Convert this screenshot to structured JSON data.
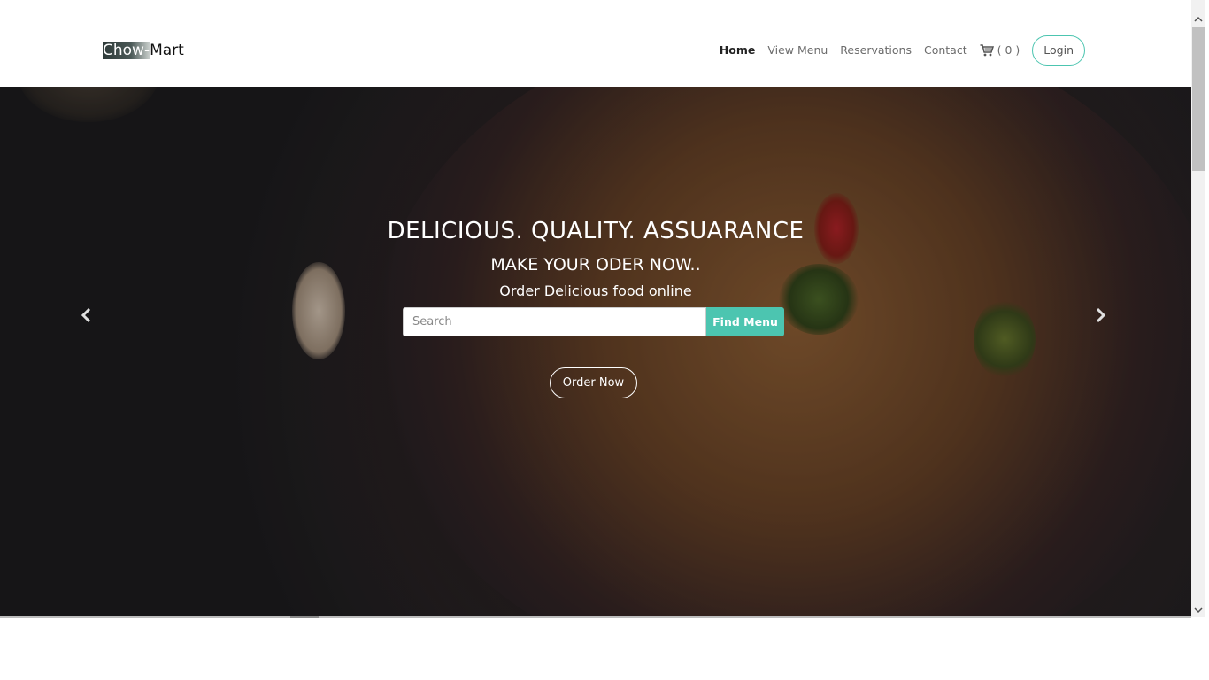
{
  "header": {
    "logo_highlight": "Chow-",
    "logo_rest": "Mart",
    "nav": [
      {
        "label": "Home",
        "active": true
      },
      {
        "label": "View Menu",
        "active": false
      },
      {
        "label": "Reservations",
        "active": false
      },
      {
        "label": "Contact",
        "active": false
      }
    ],
    "cart_label": "( 0 )",
    "login_label": "Login"
  },
  "hero": {
    "title": "DELICIOUS. QUALITY. ASSUARANCE",
    "subtitle": "MAKE YOUR ODER NOW..",
    "tagline": "Order Delicious food online",
    "search_placeholder": "Search",
    "find_button": "Find Menu",
    "order_button": "Order Now"
  },
  "colors": {
    "accent": "#4cc5b0",
    "nav_active": "#222222",
    "nav_inactive": "#6b6b6b"
  },
  "icons": {
    "cart": "cart-icon",
    "prev": "chevron-left-icon",
    "next": "chevron-right-icon"
  }
}
